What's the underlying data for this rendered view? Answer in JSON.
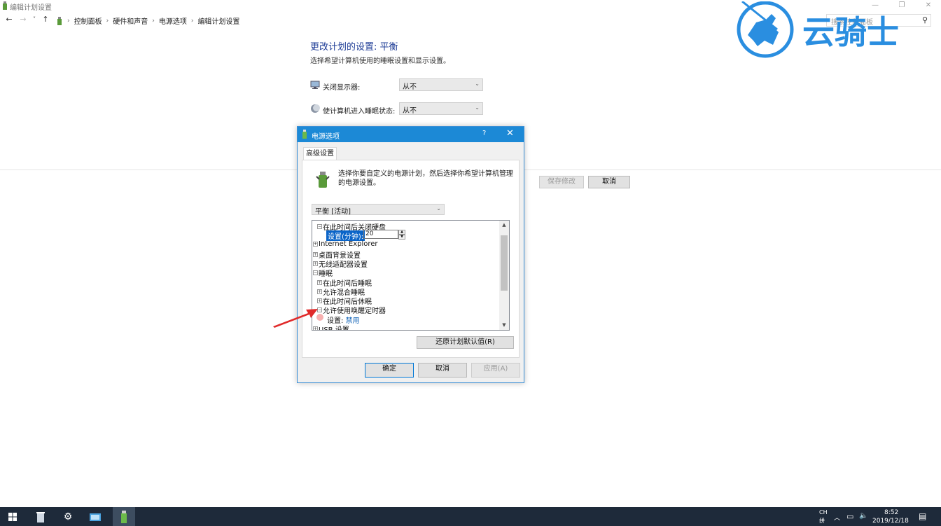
{
  "window": {
    "title": "编辑计划设置",
    "minimize": "—",
    "restore": "❐",
    "close": "✕"
  },
  "address_bar": {
    "breadcrumbs": [
      "控制面板",
      "硬件和声音",
      "电源选项",
      "编辑计划设置"
    ],
    "search_placeholder": "搜索控制面板"
  },
  "main": {
    "title": "更改计划的设置: 平衡",
    "subtitle": "选择希望计算机使用的睡眠设置和显示设置。",
    "display_off_label": "关闭显示器:",
    "display_off_value": "从不",
    "sleep_label": "使计算机进入睡眠状态:",
    "sleep_value": "从不",
    "save_label": "保存修改",
    "cancel_label": "取消"
  },
  "logo": {
    "text": "云骑士"
  },
  "dialog": {
    "title": "电源选项",
    "help": "?",
    "close": "✕",
    "tab": "高级设置",
    "description": "选择你要自定义的电源计划，然后选择你希望计算机管理的电源设置。",
    "plan": "平衡 [活动]",
    "tree": {
      "hdd_off": "在此时间后关闭硬盘",
      "setting_minutes_label": "设置(分钟):",
      "setting_minutes_value": "20",
      "ie": "Internet Explorer",
      "desktop_bg": "桌面背景设置",
      "wireless": "无线适配器设置",
      "sleep": "睡眠",
      "sleep_after": "在此时间后睡眠",
      "hybrid_sleep": "允许混合睡眠",
      "hibernate_after": "在此时间后休眠",
      "wake_timers": "允许使用唤醒定时器",
      "wake_setting_label": "设置:",
      "wake_setting_value": "禁用",
      "usb": "USB 设置"
    },
    "restore_defaults": "还原计划默认值(R)",
    "ok": "确定",
    "cancel": "取消",
    "apply": "应用(A)"
  },
  "taskbar": {
    "ime": "CH",
    "ime2": "拼",
    "time": "8:52",
    "date": "2019/12/18"
  },
  "colors": {
    "dialog_title_bg": "#1c89d6",
    "page_title": "#1e3c96",
    "taskbar_bg": "#1e2a3a",
    "logo_blue": "#2a8ee0"
  }
}
